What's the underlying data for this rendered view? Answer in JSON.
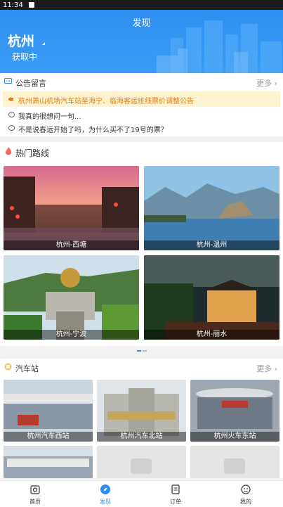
{
  "status": {
    "time": "11:34"
  },
  "header": {
    "title": "发现",
    "city": "杭州",
    "location_status": "获取中"
  },
  "notice": {
    "title": "公告留言",
    "more": "更多",
    "announcement": "杭州萧山机场汽车站至海宁、临海客运班线票价调整公告",
    "messages": [
      "我真的很想问一句...",
      "不是说春运开始了吗，为什么买不了19号的票？"
    ]
  },
  "hot_routes": {
    "title": "热门路线",
    "routes": [
      "杭州-西塘",
      "杭州-温州",
      "杭州-宁波",
      "杭州-丽水"
    ]
  },
  "stations": {
    "title": "汽车站",
    "more": "更多",
    "items": [
      "杭州汽车西站",
      "杭州汽车北站",
      "杭州火车东站"
    ]
  },
  "tabs": [
    "首页",
    "发现",
    "订单",
    "我的"
  ],
  "colors": {
    "primary": "#2f8ff0",
    "notice_bg": "#fdf3cf",
    "notice_text": "#e07b1b",
    "hot_icon": "#f06a5f"
  }
}
